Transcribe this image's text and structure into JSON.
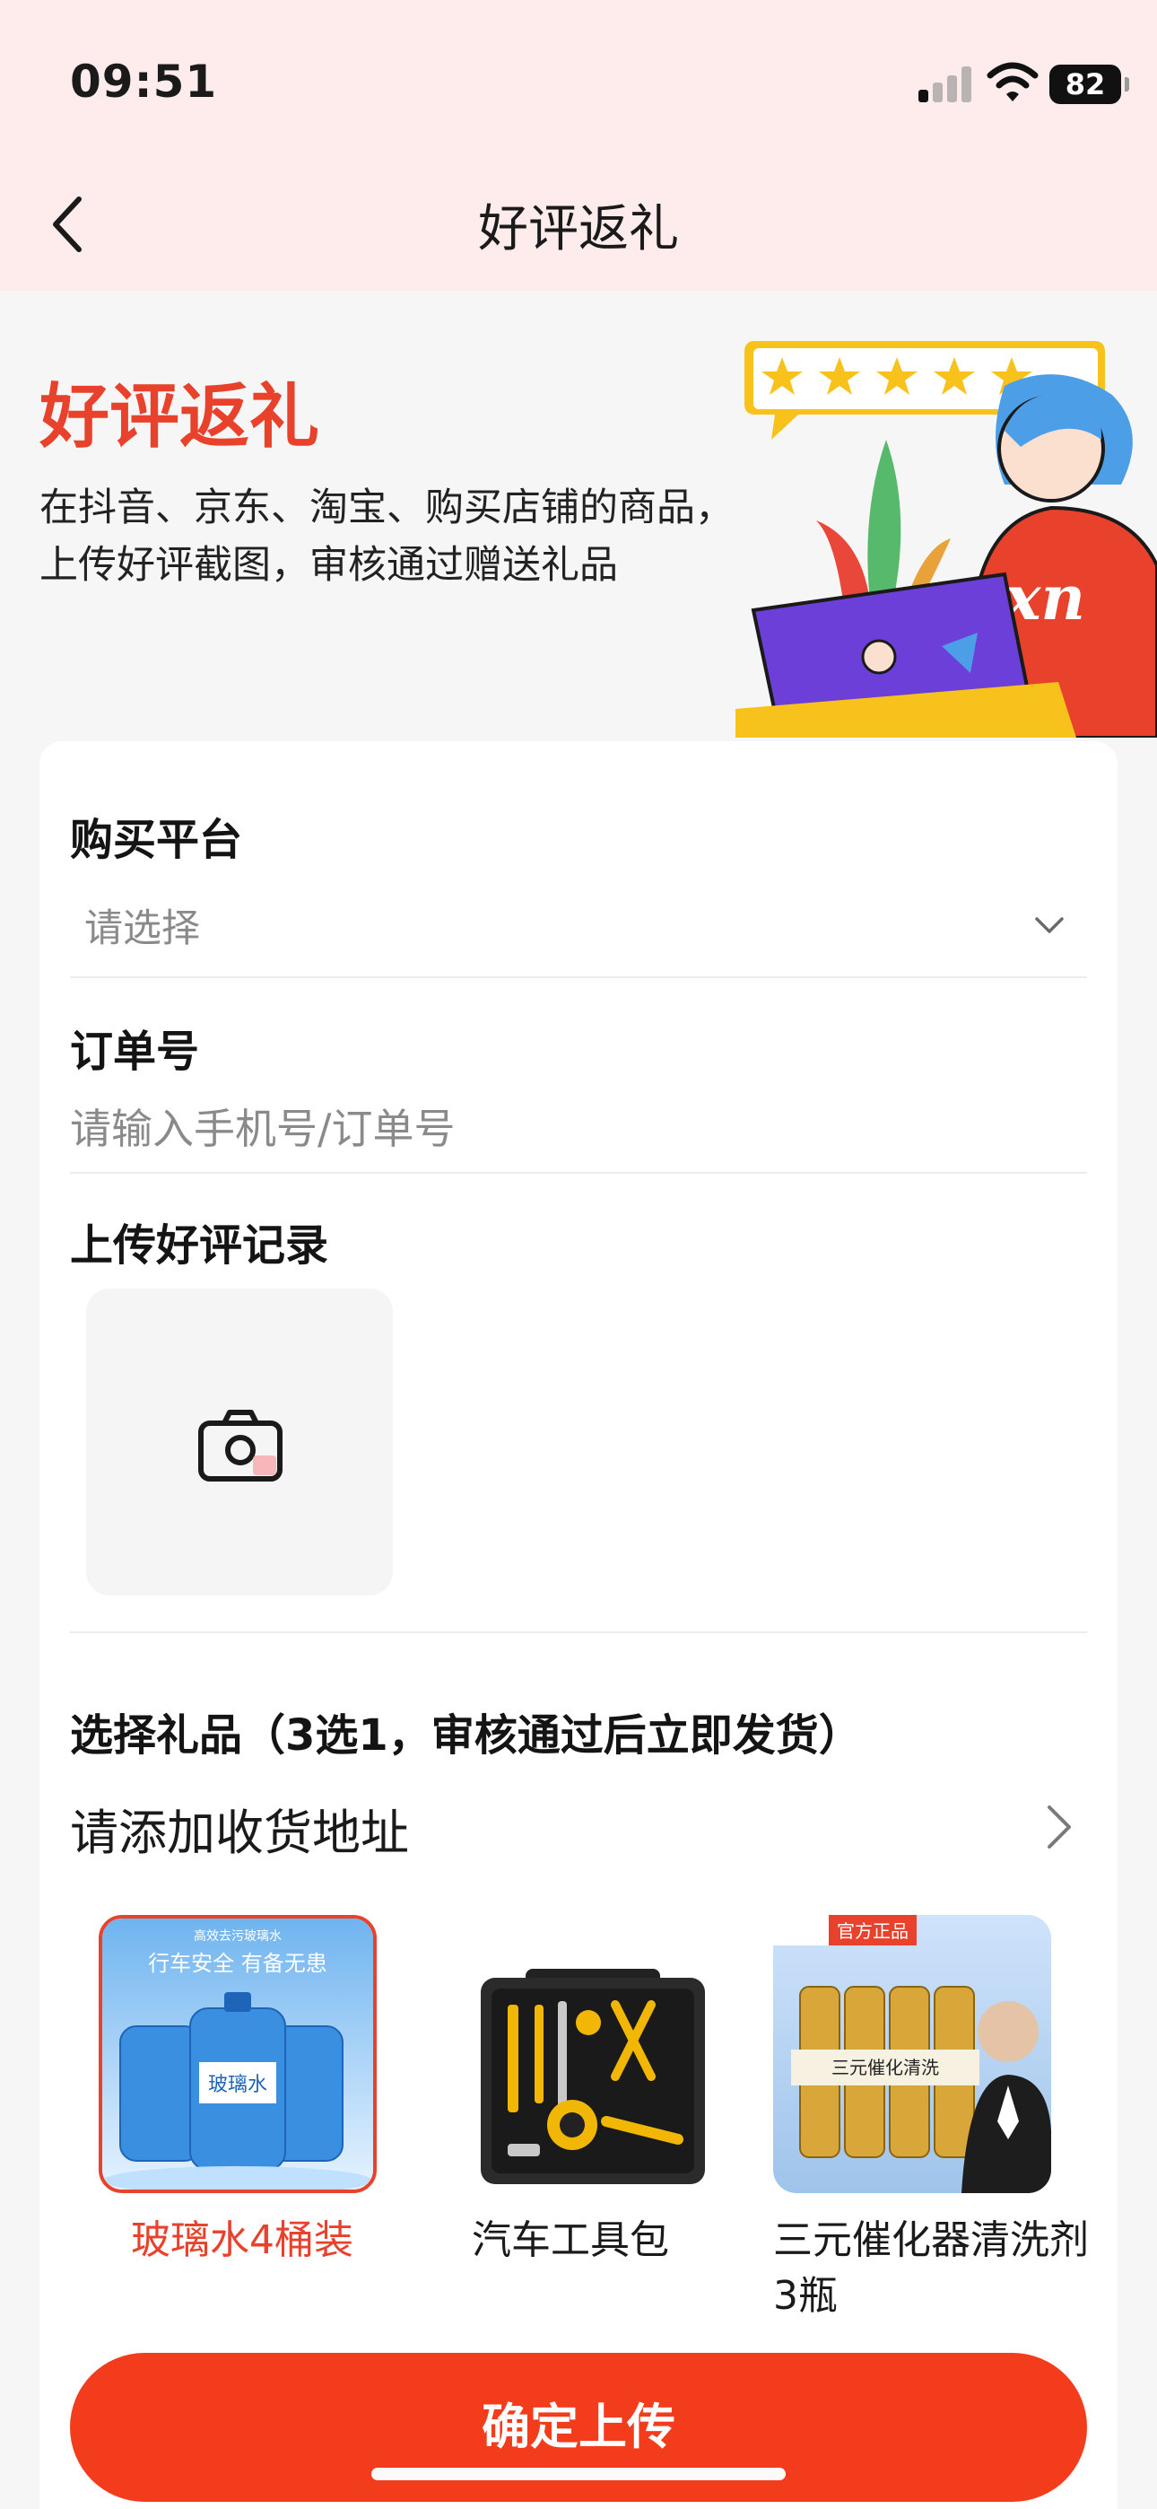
{
  "status_bar": {
    "time": "09:51",
    "battery": "82"
  },
  "nav": {
    "title": "好评返礼"
  },
  "hero": {
    "title": "好评返礼",
    "description": "在抖音、京东、淘宝、购买店铺的商品，上传好评截图，审核通过赠送礼品",
    "illustration_text": "xn"
  },
  "form": {
    "platform": {
      "label": "购买平台",
      "placeholder": "请选择"
    },
    "order": {
      "label": "订单号",
      "placeholder": "请输入手机号/订单号"
    },
    "upload": {
      "label": "上传好评记录"
    },
    "gift": {
      "label": "选择礼品（3选1，审核通过后立即发货）",
      "address": "请添加收货地址",
      "items": [
        {
          "name": "玻璃水4桶装",
          "selected": true,
          "banner": "行车安全  有备无患",
          "tag": "高效去污玻璃水",
          "bottle_label": "玻璃水"
        },
        {
          "name": "汽车工具包",
          "selected": false
        },
        {
          "name": "三元催化器清洗剂3瓶",
          "selected": false,
          "badge": "官方正品",
          "bottle_label": "三元催化清洗"
        }
      ]
    }
  },
  "submit": {
    "label": "确定上传"
  },
  "colors": {
    "accent": "#e8412c",
    "button": "#f23c1c",
    "header_bg": "#fdeceb"
  },
  "icons": [
    "back-arrow-icon",
    "chevron-down-icon",
    "camera-icon",
    "chevron-right-icon",
    "signal-icon",
    "wifi-icon",
    "battery-icon"
  ]
}
